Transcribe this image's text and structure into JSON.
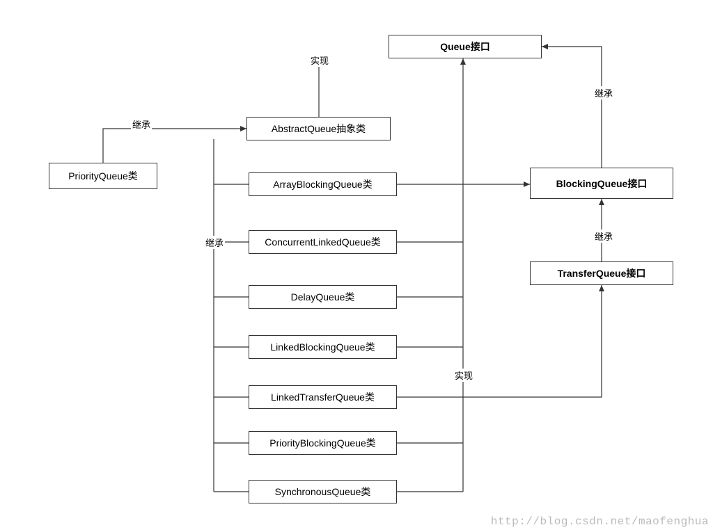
{
  "nodes": {
    "queue": "Queue接口",
    "abstractQueue": "AbstractQueue抽象类",
    "priorityQueue": "PriorityQueue类",
    "arrayBlockingQueue": "ArrayBlockingQueue类",
    "concurrentLinkedQueue": "ConcurrentLinkedQueue类",
    "delayQueue": "DelayQueue类",
    "linkedBlockingQueue": "LinkedBlockingQueue类",
    "linkedTransferQueue": "LinkedTransferQueue类",
    "priorityBlockingQueue": "PriorityBlockingQueue类",
    "synchronousQueue": "SynchronousQueue类",
    "blockingQueue": "BlockingQueue接口",
    "transferQueue": "TransferQueue接口"
  },
  "labels": {
    "implements": "实现",
    "extends": "继承"
  },
  "watermark": "http://blog.csdn.net/maofenghua"
}
